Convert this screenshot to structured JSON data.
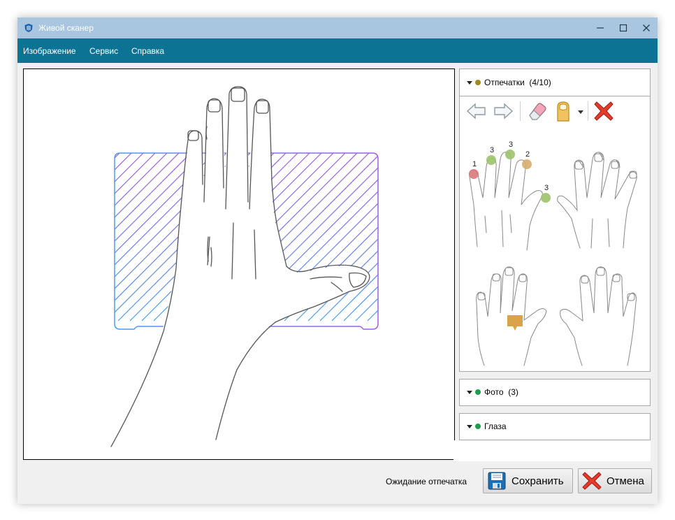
{
  "window": {
    "title": "Живой сканер",
    "controls": {
      "minimize": "minimize",
      "maximize": "maximize",
      "close": "close"
    }
  },
  "menu": [
    "Изображение",
    "Сервис",
    "Справка"
  ],
  "fingerprints_panel": {
    "title": "Отпечатки",
    "count": "(4/10)",
    "status_color": "#a08a1c",
    "toolbar": [
      "arrow-left-icon",
      "arrow-right-icon",
      "eraser-icon",
      "fingernail-icon",
      "dropdown-arrow-icon",
      "delete-x-icon"
    ],
    "finger_markers": [
      {
        "finger": "left-little",
        "count": "1",
        "color": "#d9787a"
      },
      {
        "finger": "left-ring",
        "count": "3",
        "color": "#9cc26a"
      },
      {
        "finger": "left-middle",
        "count": "3",
        "color": "#9cc26a"
      },
      {
        "finger": "left-index",
        "count": "2",
        "color": "#d7ae6e"
      },
      {
        "finger": "left-thumb",
        "count": "3",
        "color": "#9cc26a"
      }
    ]
  },
  "photo_panel": {
    "title": "Фото",
    "count": "(3)",
    "status_color": "#1aa04a"
  },
  "eyes_panel": {
    "title": "Глаза",
    "status_color": "#1aa04a"
  },
  "status": "Ожидание отпечатка",
  "buttons": {
    "save": {
      "label": "Сохранить",
      "icon": "floppy-disk-icon"
    },
    "cancel": {
      "label": "Отмена",
      "icon": "red-x-icon"
    }
  },
  "colors": {
    "menubar": "#0d7394",
    "titlebar": "#a8c6df"
  }
}
